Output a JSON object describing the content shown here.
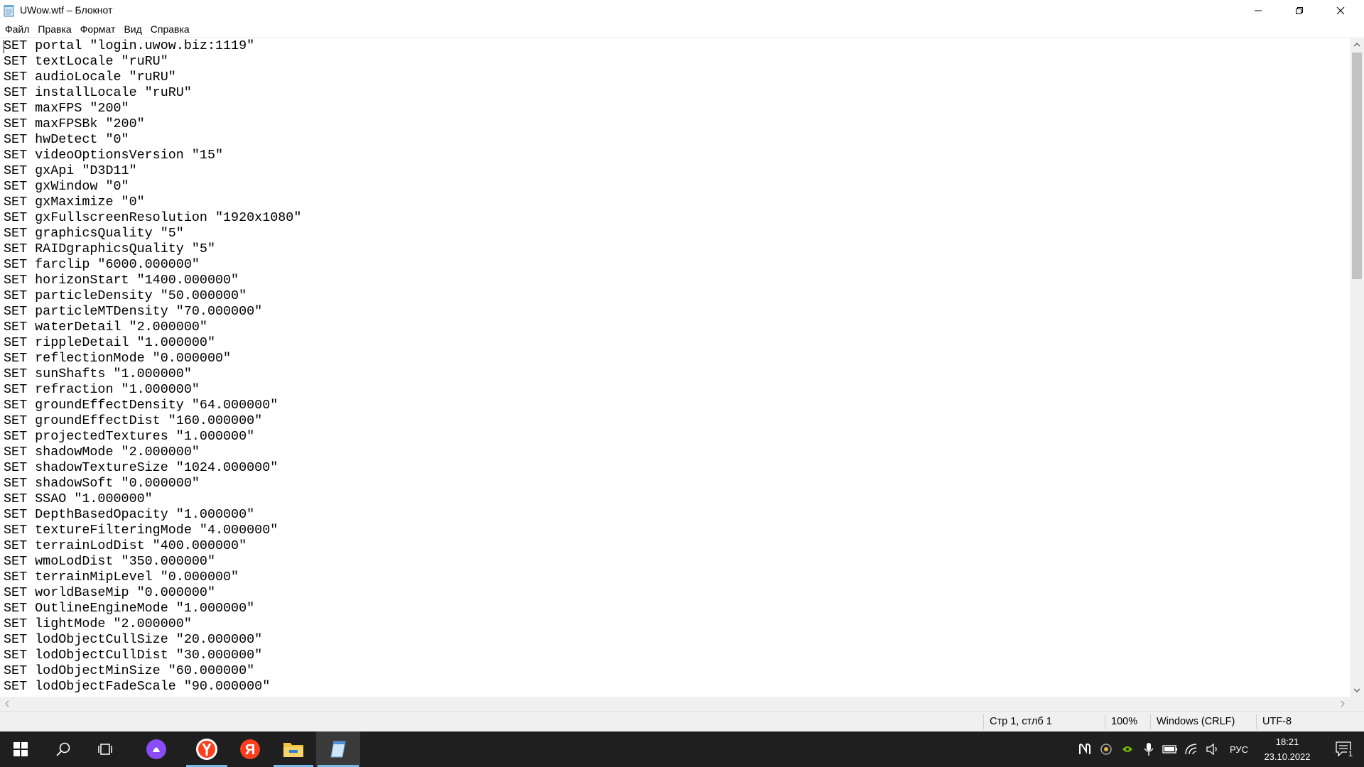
{
  "window": {
    "title": "UWow.wtf – Блокнот"
  },
  "menu": [
    "Файл",
    "Правка",
    "Формат",
    "Вид",
    "Справка"
  ],
  "editor": {
    "lines": [
      "SET portal \"login.uwow.biz:1119\"",
      "SET textLocale \"ruRU\"",
      "SET audioLocale \"ruRU\"",
      "SET installLocale \"ruRU\"",
      "SET maxFPS \"200\"",
      "SET maxFPSBk \"200\"",
      "SET hwDetect \"0\"",
      "SET videoOptionsVersion \"15\"",
      "SET gxApi \"D3D11\"",
      "SET gxWindow \"0\"",
      "SET gxMaximize \"0\"",
      "SET gxFullscreenResolution \"1920x1080\"",
      "SET graphicsQuality \"5\"",
      "SET RAIDgraphicsQuality \"5\"",
      "SET farclip \"6000.000000\"",
      "SET horizonStart \"1400.000000\"",
      "SET particleDensity \"50.000000\"",
      "SET particleMTDensity \"70.000000\"",
      "SET waterDetail \"2.000000\"",
      "SET rippleDetail \"1.000000\"",
      "SET reflectionMode \"0.000000\"",
      "SET sunShafts \"1.000000\"",
      "SET refraction \"1.000000\"",
      "SET groundEffectDensity \"64.000000\"",
      "SET groundEffectDist \"160.000000\"",
      "SET projectedTextures \"1.000000\"",
      "SET shadowMode \"2.000000\"",
      "SET shadowTextureSize \"1024.000000\"",
      "SET shadowSoft \"0.000000\"",
      "SET SSAO \"1.000000\"",
      "SET DepthBasedOpacity \"1.000000\"",
      "SET textureFilteringMode \"4.000000\"",
      "SET terrainLodDist \"400.000000\"",
      "SET wmoLodDist \"350.000000\"",
      "SET terrainMipLevel \"0.000000\"",
      "SET worldBaseMip \"0.000000\"",
      "SET OutlineEngineMode \"1.000000\"",
      "SET lightMode \"2.000000\"",
      "SET lodObjectCullSize \"20.000000\"",
      "SET lodObjectCullDist \"30.000000\"",
      "SET lodObjectMinSize \"60.000000\"",
      "SET lodObjectFadeScale \"90.000000\""
    ]
  },
  "statusbar": {
    "position": "Стр 1, стлб 1",
    "zoom": "100%",
    "line_ending": "Windows (CRLF)",
    "encoding": "UTF-8"
  },
  "scrollbar": {
    "vertical_thumb_fraction": 0.36
  },
  "taskbar": {
    "tray_language": "РУС",
    "time": "18:21",
    "date": "23.10.2022",
    "notification_count": "1"
  },
  "colors": {
    "taskbar_bg": "#1f1f1f",
    "active_indicator": "#76b9ed",
    "yandex_red": "#fc3f1d",
    "alice_purple": "#8a4cf7"
  }
}
